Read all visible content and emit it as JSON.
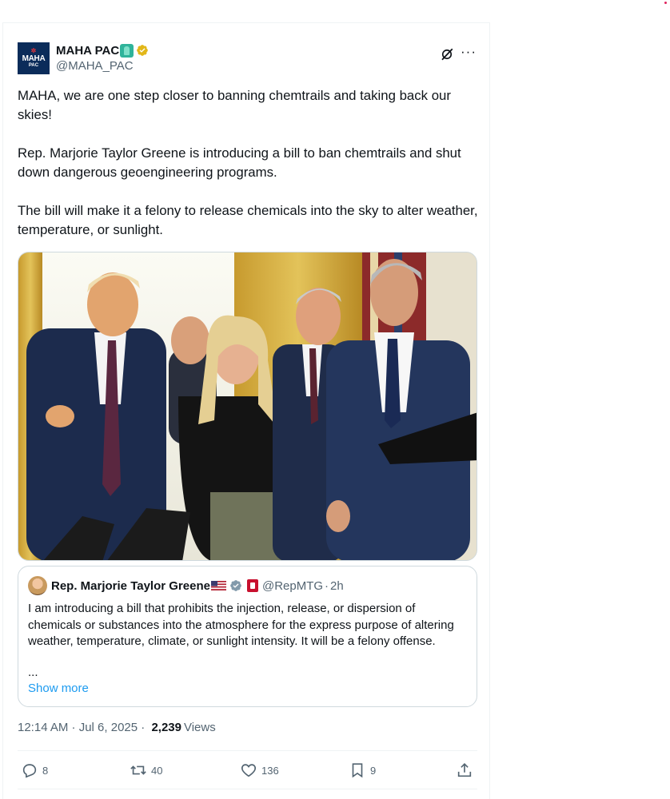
{
  "tweet": {
    "author": {
      "display_name": "MAHA PAC",
      "handle": "@MAHA_PAC",
      "avatar_text": "MAHA",
      "avatar_sub": "PAC"
    },
    "paragraphs": [
      "MAHA, we are one step closer to banning chemtrails and taking back our skies!",
      "Rep. Marjorie Taylor Greene is introducing a bill to ban chemtrails and shut down dangerous geoengineering programs.",
      "The bill will make it a felony to release chemicals into the sky to alter weather, temperature, or sunlight."
    ],
    "quote": {
      "display_name": "Rep. Marjorie Taylor Greene",
      "handle": "@RepMTG",
      "time": "2h",
      "text": "I am introducing a bill that prohibits the injection, release, or dispersion of chemicals or substances into the atmosphere for the express purpose of altering weather, temperature, climate, or sunlight intensity. It will be a felony offense.",
      "ellipsis": "...",
      "show_more": "Show more"
    },
    "timestamp": "12:14 AM · Jul 6, 2025 · ",
    "views_count": "2,239",
    "views_label": "Views",
    "actions": {
      "replies": "8",
      "reposts": "40",
      "likes": "136",
      "bookmarks": "9"
    }
  },
  "colors": {
    "accent": "#1d9bf0",
    "secondary_text": "#536471",
    "border": "#cfd9de",
    "verified_gold": "#e2b719",
    "verified_gray": "#829aab"
  }
}
